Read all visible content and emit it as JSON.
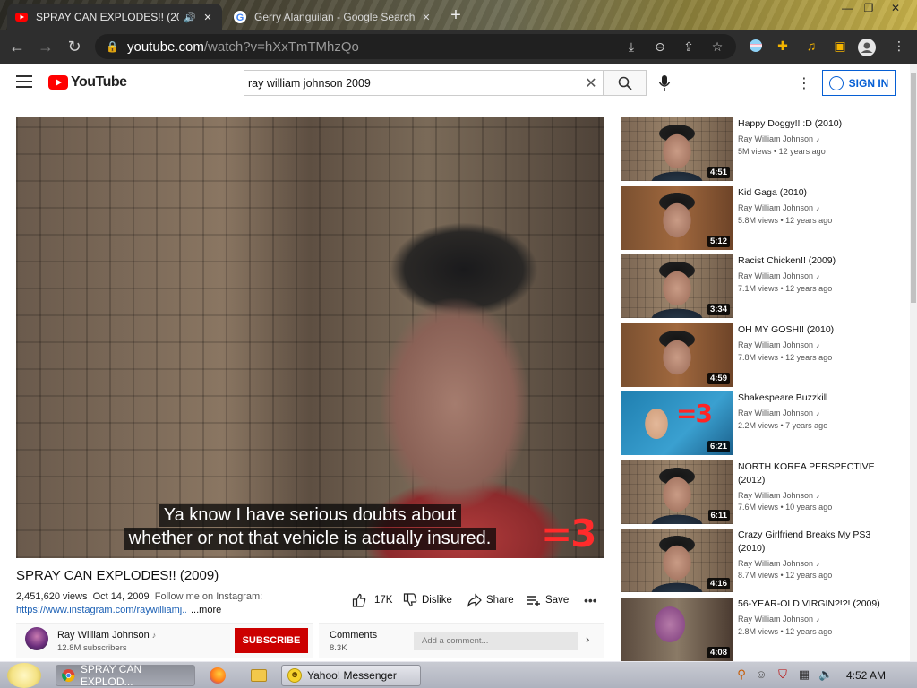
{
  "browser": {
    "tabs": [
      {
        "title": "SPRAY CAN EXPLODES!! (2009",
        "audio": true
      },
      {
        "title": "Gerry Alanguilan - Google Search"
      }
    ],
    "url_host": "youtube.com",
    "url_path": "/watch?v=hXxTmTMhzQo"
  },
  "youtube": {
    "logo_text": "YouTube",
    "search_value": "ray william johnson 2009",
    "signin_label": "SIGN IN",
    "video": {
      "caption_line1": "Ya know I have serious doubts about",
      "caption_line2": "whether or not that vehicle is actually insured.",
      "watermark": "=3",
      "title": "SPRAY CAN EXPLODES!! (2009)",
      "views": "2,451,620 views",
      "date": "Oct 14, 2009",
      "description": "Follow me on Instagram:",
      "link": "https://www.instagram.com/raywilliamj...",
      "more_label": "...more",
      "likes": "17K",
      "dislike_label": "Dislike",
      "share_label": "Share",
      "save_label": "Save"
    },
    "channel": {
      "name": "Ray William Johnson",
      "subscribers": "12.8M subscribers",
      "subscribe_label": "SUBSCRIBE"
    },
    "comments": {
      "title": "Comments",
      "count": "8.3K",
      "placeholder": "Add a comment..."
    },
    "recommendations": [
      {
        "title": "Happy Doggy!! :D (2010)",
        "channel": "Ray William Johnson",
        "meta": "5M views • 12 years ago",
        "duration": "4:51"
      },
      {
        "title": "Kid Gaga (2010)",
        "channel": "Ray William Johnson",
        "meta": "5.8M views • 12 years ago",
        "duration": "5:12"
      },
      {
        "title": "Racist Chicken!! (2009)",
        "channel": "Ray William Johnson",
        "meta": "7.1M views • 12 years ago",
        "duration": "3:34"
      },
      {
        "title": "OH MY GOSH!! (2010)",
        "channel": "Ray William Johnson",
        "meta": "7.8M views • 12 years ago",
        "duration": "4:59"
      },
      {
        "title": "Shakespeare Buzzkill",
        "channel": "Ray William Johnson",
        "meta": "2.2M views • 7 years ago",
        "duration": "6:21",
        "badge": "=3"
      },
      {
        "title": "NORTH KOREA PERSPECTIVE (2012)",
        "channel": "Ray William Johnson",
        "meta": "7.6M views • 10 years ago",
        "duration": "6:11"
      },
      {
        "title": "Crazy Girlfriend Breaks My PS3 (2010)",
        "channel": "Ray William Johnson",
        "meta": "8.7M views • 12 years ago",
        "duration": "4:16"
      },
      {
        "title": "56-YEAR-OLD VIRGIN?!?! (2009)",
        "channel": "Ray William Johnson",
        "meta": "2.8M views • 12 years ago",
        "duration": "4:08"
      }
    ]
  },
  "taskbar": {
    "items": [
      {
        "label": "SPRAY CAN EXPLOD...",
        "icon": "chrome-icon"
      },
      {
        "label": "",
        "icon": "firefox-icon"
      },
      {
        "label": "",
        "icon": "folder-icon"
      },
      {
        "label": "Yahoo! Messenger",
        "icon": "yahoo-messenger-icon"
      }
    ],
    "clock": "4:52 AM"
  },
  "colors": {
    "yt_red": "#ff0000",
    "subscribe_red": "#cc0000",
    "link_blue": "#065fd4",
    "chrome_dark": "#2e2e2e"
  }
}
